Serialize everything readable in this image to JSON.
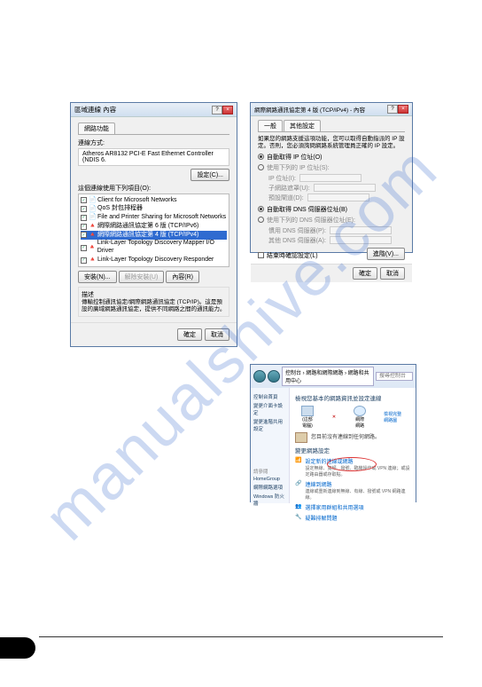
{
  "watermark": "manualshive.com",
  "dlg1": {
    "title": "區域連線 內容",
    "tab": "網路功能",
    "connect_label": "連線方式:",
    "adapter": "Atheros AR8132 PCI-E Fast Ethernet Controller (NDIS 6.",
    "config_btn": "設定(C)...",
    "uses_label": "這個連線使用下列項目(O):",
    "items": [
      "Client for Microsoft Networks",
      "QoS 封包排程器",
      "File and Printer Sharing for Microsoft Networks",
      "網際網路通訊協定第 6 版 (TCP/IPv6)",
      "網際網路通訊協定第 4 版 (TCP/IPv4)",
      "Link-Layer Topology Discovery Mapper I/O Driver",
      "Link-Layer Topology Discovery Responder"
    ],
    "install_btn": "安裝(N)...",
    "uninstall_btn": "解除安裝(U)",
    "props_btn": "內容(R)",
    "desc_label": "描述",
    "desc_text": "傳輸控制通訊協定/網際網路通訊協定 (TCP/IP)。這是預設的廣域網路通訊協定，提供不同網路之間的通訊能力。",
    "ok": "確定",
    "cancel": "取消"
  },
  "dlg2": {
    "title": "網際網路通訊協定第 4 版 (TCP/IPv4) - 內容",
    "tab1": "一般",
    "tab2": "其他設定",
    "info": "如果您的網路支援這項功能，您可以取得自動指派的 IP 設定。否則，您必須詢問網路系統管理員正確的 IP 設定。",
    "auto_ip": "自動取得 IP 位址(O)",
    "manual_ip": "使用下列的 IP 位址(S):",
    "ip_label": "IP 位址(I):",
    "mask_label": "子網路遮罩(U):",
    "gw_label": "預設閘道(D):",
    "auto_dns": "自動取得 DNS 伺服器位址(B)",
    "manual_dns": "使用下列的 DNS 伺服器位址(E):",
    "dns1": "慣用 DNS 伺服器(P):",
    "dns2": "其他 DNS 伺服器(A):",
    "validate": "結束時確認設定(L)",
    "advanced": "進階(V)...",
    "ok": "確定",
    "cancel": "取消"
  },
  "dlg3": {
    "breadcrumb": "控制台 › 網路和網際網路 › 網路和共用中心",
    "search_ph": "搜尋控制台",
    "side": {
      "home": "控制台首頁",
      "l1": "變更介面卡設定",
      "l2": "變更進階共用設定",
      "see": "請參閱",
      "s1": "HomeGroup",
      "s2": "網際網路選項",
      "s3": "Windows 防火牆"
    },
    "main_hdr": "檢視您基本的網路資訊並設定連線",
    "map_left": "(這部電腦)",
    "map_right": "網際網路",
    "full_map": "檢視完整網路圖",
    "net_hdr": "變更網路設定",
    "i1": "設定新的連線或網路",
    "i1s": "設定無線、寬頻、撥號、臨機操作或 VPN 連線；或設定路由器或存取點。",
    "i2": "連線到網路",
    "i2s": "連線或重新連線到無線、有線、撥號或 VPN 網路連線。",
    "i3": "選擇家用群組和共用選項",
    "i4": "疑難排解問題"
  }
}
